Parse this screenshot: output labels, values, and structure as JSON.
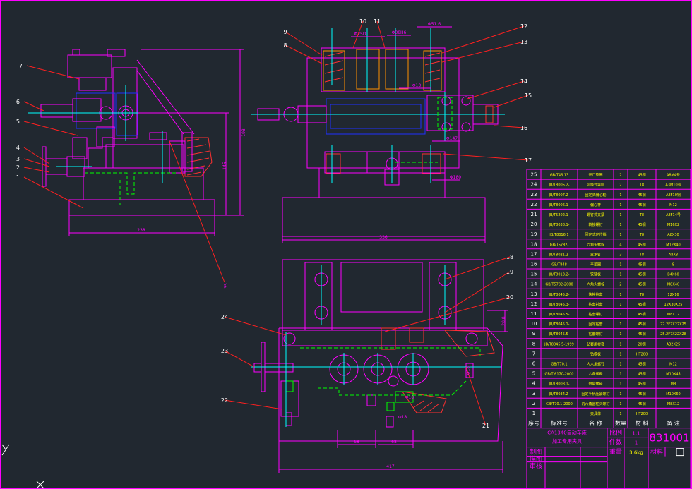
{
  "colors": {
    "background": "#212830",
    "outline": "#ff00ff",
    "leader": "#ff2020",
    "centerline": "#00ffff",
    "hidden": "#00ff00",
    "body": "#2030ff",
    "hatch": "#ff3030",
    "gear": "#ff9000",
    "white": "#ffffff",
    "table_text": "#ffff00"
  },
  "left_view_callouts": [
    "7",
    "6",
    "5",
    "4",
    "3",
    "2",
    "1"
  ],
  "top_view_callouts": [
    "9",
    "8",
    "10",
    "11",
    "12",
    "13",
    "14",
    "15",
    "16",
    "17"
  ],
  "bottom_view_callouts": [
    "18",
    "19",
    "20",
    "24",
    "23",
    "22",
    "21"
  ],
  "dimensions": {
    "left_width": "238",
    "left_h1": "198",
    "left_h2": "145",
    "left_misc": "35",
    "top_width": "336",
    "bottom_width": "417",
    "bottom_d1": "68",
    "bottom_d2": "68",
    "top_d1": "Φ25D",
    "top_d2": "Φ38H6",
    "top_d3": "Φ51.6",
    "top_d4": "Φ13",
    "top_d5": "Φ147",
    "top_d6": "Φ180",
    "top_d7": "20.8",
    "bottom_d3": "Φ18",
    "bottom_d4": "Φ18",
    "bottom_d5": "Φ18"
  },
  "parts_table": {
    "rows": [
      {
        "no": "25",
        "std": "GB/T46 13",
        "name": "开口垫圈",
        "qty": "2",
        "mat": "45钢",
        "note": "A8M4号"
      },
      {
        "no": "24",
        "std": "JB/T8005.2-",
        "name": "可换式导向",
        "qty": "2",
        "mat": "T8",
        "note": "A3M10号"
      },
      {
        "no": "23",
        "std": "JB/T8007.2-",
        "name": "固定式偏心轮",
        "qty": "1",
        "mat": "45钢",
        "note": "A8F10钢"
      },
      {
        "no": "22",
        "std": "JB/T8006.1-",
        "name": "偏心杆",
        "qty": "1",
        "mat": "45钢",
        "note": "M12"
      },
      {
        "no": "21",
        "std": "JB/T5202.1-",
        "name": "螺钉式夹紧",
        "qty": "1",
        "mat": "T8",
        "note": "A8F14号"
      },
      {
        "no": "20",
        "std": "JB/T8038.1-",
        "name": "转接螺钉",
        "qty": "1",
        "mat": "45钢",
        "note": "M16X2"
      },
      {
        "no": "19",
        "std": "JB/T8016.1",
        "name": "固定式定位销",
        "qty": "1",
        "mat": "T8",
        "note": "A8X30"
      },
      {
        "no": "18",
        "std": "GB/T5782-",
        "name": "六角头螺栓",
        "qty": "4",
        "mat": "45钢",
        "note": "M12X40"
      },
      {
        "no": "17",
        "std": "JB/T8021.2-",
        "name": "支承钉",
        "qty": "3",
        "mat": "T8",
        "note": "A8X8"
      },
      {
        "no": "16",
        "std": "GB/T848",
        "name": "平垫圈",
        "qty": "1",
        "mat": "45钢",
        "note": "8"
      },
      {
        "no": "15",
        "std": "JB/T8013.2-",
        "name": "铰链板",
        "qty": "1",
        "mat": "45钢",
        "note": "B4X60"
      },
      {
        "no": "14",
        "std": "GB/T5782-2000",
        "name": "六角头螺栓",
        "qty": "2",
        "mat": "45钢",
        "note": "M8X40"
      },
      {
        "no": "13",
        "std": "JB/T8045.2-",
        "name": "快换钻套",
        "qty": "1",
        "mat": "T8",
        "note": "12X16"
      },
      {
        "no": "12",
        "std": "JB/T8045.3-",
        "name": "钻套衬套",
        "qty": "1",
        "mat": "45钢",
        "note": "12X30X25"
      },
      {
        "no": "11",
        "std": "JB/T8045.5-",
        "name": "钻套螺钉",
        "qty": "1",
        "mat": "45钢",
        "note": "M8X12"
      },
      {
        "no": "10",
        "std": "JB/T8045.1-",
        "name": "固定钻套",
        "qty": "1",
        "mat": "45钢",
        "note": "22.2F7X22X25"
      },
      {
        "no": "9",
        "std": "JB/T8045.5-",
        "name": "钻套螺钉",
        "qty": "1",
        "mat": "45钢",
        "note": "25.2F7X22X28"
      },
      {
        "no": "8",
        "std": "JB/T8045.5-1999",
        "name": "钻套用衬套",
        "qty": "1",
        "mat": "20钢",
        "note": "A32X25"
      },
      {
        "no": "7",
        "std": "",
        "name": "钻模板",
        "qty": "1",
        "mat": "HT200",
        "note": ""
      },
      {
        "no": "6",
        "std": "GB/T70.1",
        "name": "内六角螺钉",
        "qty": "1",
        "mat": "45钢",
        "note": "M12"
      },
      {
        "no": "5",
        "std": "GB/T 6170-2000",
        "name": "六角螺母",
        "qty": "1",
        "mat": "45钢",
        "note": "M10X45"
      },
      {
        "no": "4",
        "std": "JB/T8008.1-",
        "name": "带肩螺母",
        "qty": "1",
        "mat": "45钢",
        "note": "M8"
      },
      {
        "no": "3",
        "std": "JB/T8034.2-",
        "name": "固定手柄压紧螺钉",
        "qty": "1",
        "mat": "45钢",
        "note": "M10X60"
      },
      {
        "no": "2",
        "std": "GB/T70.1-2000",
        "name": "内六角圆柱头螺钉",
        "qty": "1",
        "mat": "45钢",
        "note": "M8X12"
      },
      {
        "no": "1",
        "std": "",
        "name": "夹具体",
        "qty": "1",
        "mat": "HT200",
        "note": ""
      }
    ],
    "header": {
      "no": "序号",
      "std": "标准号",
      "name": "名 称",
      "qty": "数量",
      "mat": "材 料",
      "note": "备 注"
    }
  },
  "title_block": {
    "part_name_l1": "CA1340自动车床",
    "part_name_l2": "加工专用夹具",
    "scale_label": "比例",
    "scale_value": "1:1",
    "count_label": "件数",
    "count_value": "1",
    "weight_label": "重量",
    "weight_value": "3.6kg",
    "material_label": "材料",
    "drawing_no": "831001",
    "draw_label": "制图",
    "check_label": "描图",
    "review_label": "审核"
  }
}
